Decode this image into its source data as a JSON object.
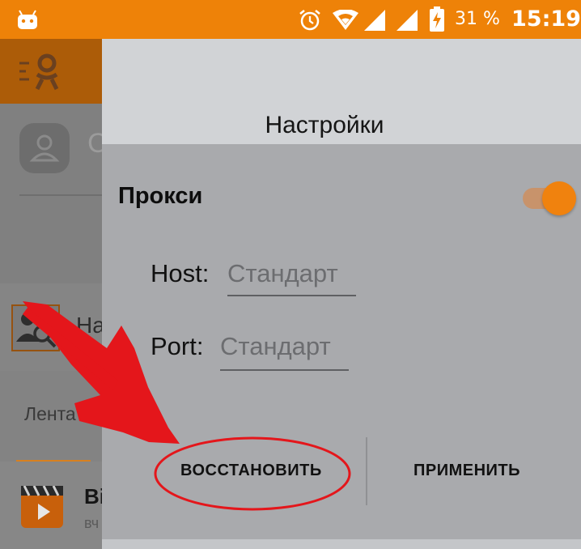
{
  "status_bar": {
    "battery": "31 %",
    "time": "15:19",
    "icons": [
      "android-icon",
      "alarm-icon",
      "wifi-icon",
      "signal-icon",
      "signal-icon",
      "battery-charging-icon"
    ]
  },
  "app": {
    "logo": "ok-logo-icon",
    "name_fragment": "C",
    "search_fragment": "На",
    "feed_tab": "Лента",
    "video_title_fragment": "Ві",
    "video_sub_fragment": "вч"
  },
  "dialog": {
    "title": "Настройки",
    "proxy_label": "Прокси",
    "proxy_enabled": true,
    "host_label": "Host:",
    "host_value": "Стандарт",
    "port_label": "Port:",
    "port_value": "Стандарт",
    "restore_button": "ВОССТАНОВИТЬ",
    "apply_button": "ПРИМЕНИТЬ"
  },
  "colors": {
    "accent": "#ee8208",
    "annotation": "#e4161b"
  }
}
